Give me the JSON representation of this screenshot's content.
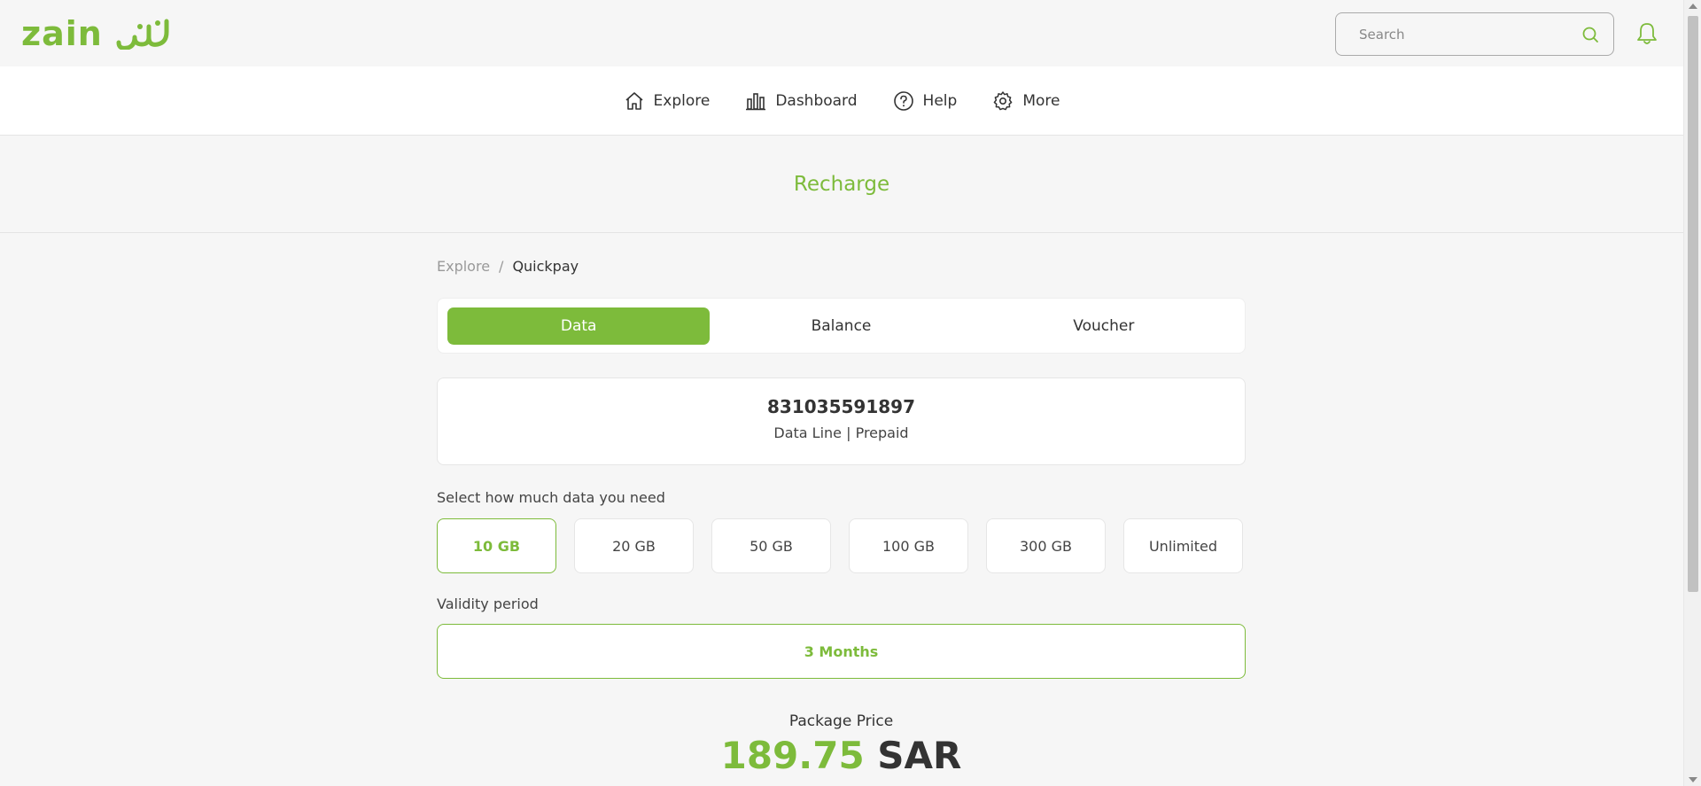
{
  "brand": {
    "latin": "zain",
    "accent_color": "#7dbb3b"
  },
  "search": {
    "placeholder": "Search",
    "icon": "search-icon"
  },
  "notifications": {
    "icon": "bell-icon"
  },
  "nav": {
    "items": [
      {
        "label": "Explore",
        "icon": "home-icon"
      },
      {
        "label": "Dashboard",
        "icon": "bar-chart-icon"
      },
      {
        "label": "Help",
        "icon": "question-circle-icon"
      },
      {
        "label": "More",
        "icon": "gear-icon"
      }
    ]
  },
  "page": {
    "title": "Recharge"
  },
  "breadcrumb": {
    "items": [
      "Explore",
      "Quickpay"
    ],
    "separator": "/"
  },
  "tabs": {
    "items": [
      "Data",
      "Balance",
      "Voucher"
    ],
    "active": "Data"
  },
  "line": {
    "number": "831035591897",
    "type": "Data Line | Prepaid"
  },
  "data_selection": {
    "label": "Select how much data you need",
    "options": [
      "10 GB",
      "20 GB",
      "50 GB",
      "100 GB",
      "300 GB",
      "Unlimited"
    ],
    "selected": "10 GB"
  },
  "validity": {
    "label": "Validity period",
    "value": "3 Months"
  },
  "price": {
    "label": "Package Price",
    "amount": "189.75",
    "currency": "SAR"
  }
}
